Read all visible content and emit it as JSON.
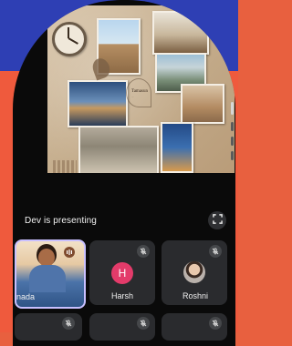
{
  "screen": {
    "presenting_text": "Dev is presenting",
    "fullscreen_icon": "fullscreen-icon"
  },
  "participants": [
    {
      "name": "nada",
      "muted": false,
      "speaking": true,
      "video": true
    },
    {
      "name": "Harsh",
      "muted": true,
      "avatar_letter": "H",
      "avatar_color": "#e33b6a"
    },
    {
      "name": "Roshni",
      "muted": true,
      "avatar": "photo"
    }
  ],
  "collage": {
    "title": "Tamasun",
    "caption": "..."
  },
  "colors": {
    "top_band": "#2e3fb4",
    "background": "#ef5a3d",
    "tile": "#2a2b2e",
    "active_speaker_border": "#c9c0ff"
  }
}
